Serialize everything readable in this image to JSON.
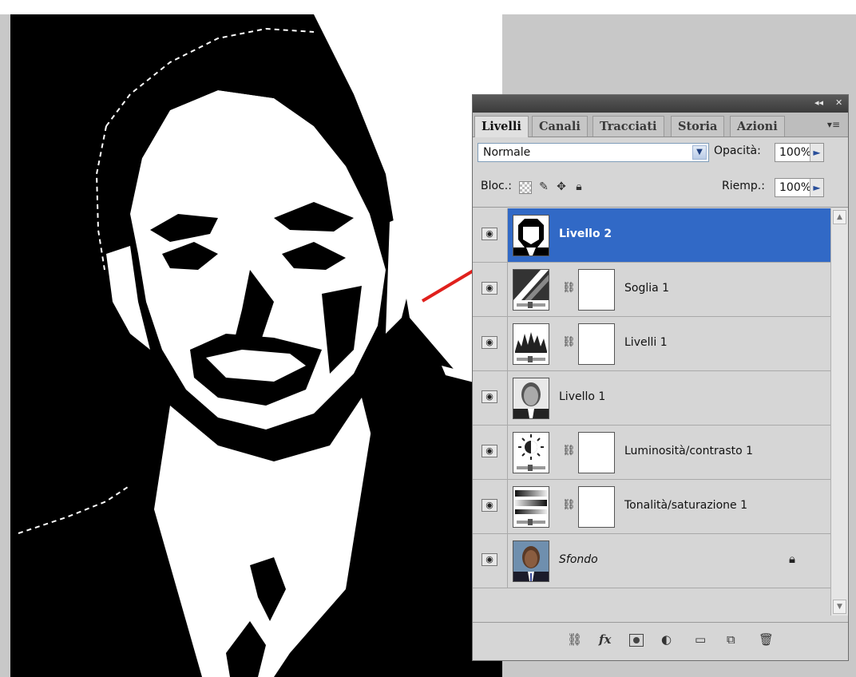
{
  "panel": {
    "title_controls": {
      "collapse": "◂◂",
      "close": "✕"
    },
    "tabs": [
      {
        "label": "Livelli",
        "active": true
      },
      {
        "label": "Canali",
        "active": false
      },
      {
        "label": "Tracciati",
        "active": false
      },
      {
        "label": "Storia",
        "active": false
      },
      {
        "label": "Azioni",
        "active": false
      }
    ],
    "menu_icon": "panel-menu-icon",
    "blend_mode": "Normale",
    "opacity_label": "Opacità:",
    "opacity_value": "100%",
    "lock_label": "Bloc.:",
    "fill_label": "Riemp.:",
    "fill_value": "100%",
    "layers": [
      {
        "name": "Livello 2",
        "selected": true,
        "type": "pixel"
      },
      {
        "name": "Soglia 1",
        "selected": false,
        "type": "adjustment-threshold"
      },
      {
        "name": "Livelli 1",
        "selected": false,
        "type": "adjustment-levels"
      },
      {
        "name": "Livello 1",
        "selected": false,
        "type": "pixel"
      },
      {
        "name": "Luminosità/contrasto 1",
        "selected": false,
        "type": "adjustment-brightness"
      },
      {
        "name": "Tonalità/saturazione 1",
        "selected": false,
        "type": "adjustment-hue"
      },
      {
        "name": "Sfondo",
        "selected": false,
        "type": "background",
        "locked": true
      }
    ],
    "bottom_icons": [
      "link-icon",
      "fx-icon",
      "mask-icon",
      "adjustment-icon",
      "folder-icon",
      "new-layer-icon",
      "trash-icon"
    ],
    "fx_label": "fx"
  },
  "colors": {
    "selection": "#3169c6",
    "annotation_arrow": "#e0201c"
  }
}
